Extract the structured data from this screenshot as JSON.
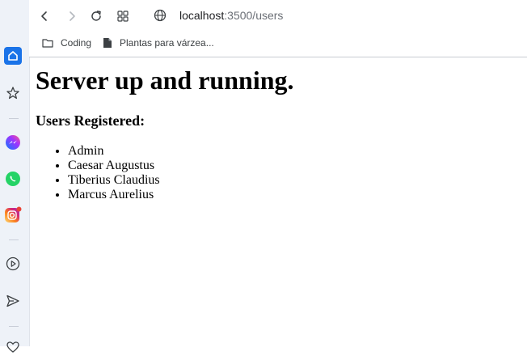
{
  "browser": {
    "address_host": "localhost",
    "address_path": ":3500/users",
    "bookmarks": [
      {
        "label": "Coding",
        "icon": "folder-icon"
      },
      {
        "label": "Plantas para várzea...",
        "icon": "page-icon"
      }
    ]
  },
  "page": {
    "title": "Server up and running.",
    "subtitle": "Users Registered:",
    "users": [
      "Admin",
      "Caesar Augustus",
      "Tiberius Claudius",
      "Marcus Aurelius"
    ]
  },
  "colors": {
    "sidebar_bg": "#eef2f8",
    "accent": "#1a73e8"
  }
}
